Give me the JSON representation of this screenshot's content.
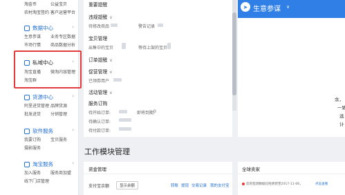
{
  "sidebar": {
    "top_rows": [
      {
        "a": "淘金币",
        "b": "公益宝贝"
      },
      {
        "a": "农村淘宝签约",
        "b": "客户运营平台"
      }
    ],
    "sections": [
      {
        "title": "数据中心",
        "items": [
          [
            "生意参谋",
            "业务专区数据"
          ],
          [
            "市场行情",
            "商品数据分析"
          ]
        ]
      },
      {
        "title": "私域中心",
        "items": [
          [
            "淘宝直播",
            "微淘内容管理"
          ],
          [
            "淘宝群",
            ""
          ]
        ]
      },
      {
        "title": "货源中心",
        "items": [
          [
            "阿里进货管理",
            "品牌货源"
          ],
          [
            "批发进货",
            "分销管理"
          ]
        ]
      },
      {
        "title": "软件服务",
        "items": [
          [
            "我要订购",
            "宝贝服务"
          ],
          [
            "摄影服务",
            ""
          ]
        ]
      },
      {
        "title": "淘宝服务",
        "items": [
          [
            "加入服务",
            "服务商加盟"
          ],
          [
            "线下门店管理",
            ""
          ]
        ]
      }
    ]
  },
  "main": {
    "top_header": "重要提醒",
    "groups": [
      {
        "title": "违规提醒",
        "rows": [
          [
            "待修改商品",
            "警告记录"
          ]
        ]
      },
      {
        "title": "宝贝管理",
        "rows": [
          [
            "出售中的宝贝",
            "等待上架的宝贝"
          ]
        ]
      },
      {
        "title": "订单提醒",
        "rows": []
      },
      {
        "title": "促营管理",
        "rows": [
          [
            "已领券用户",
            ""
          ]
        ]
      },
      {
        "title": "活动管理",
        "rows": []
      }
    ],
    "service_orders": {
      "title": "服务订购",
      "rows": [
        "待开始订单:",
        "待确认订单:",
        "待付款订单:"
      ],
      "right_label": "即将到期:",
      "right_value": "0"
    },
    "workspace_title": "工作模块管理",
    "funds": {
      "title": "资金管理",
      "balance_label": "支付宝余额",
      "show_balance_btn": "显示余额",
      "links": [
        "转账",
        "提现",
        "交易记录",
        "我的支付宝"
      ]
    }
  },
  "right": {
    "banner_text": "生意参谋",
    "banner_icon": "compass-icon",
    "side_text_1": "余，",
    "side_text_2": "一致",
    "side_text_3": "选",
    "side_text_4": "计",
    "news_title": "全球卖家",
    "news_line": "您的检测数据已经更新至2017-11-06，",
    "news_link": "点击查看"
  },
  "colors": {
    "accent": "#1f6fd1",
    "banner": "#2f7fe6",
    "highlight": "#e33b3b"
  }
}
